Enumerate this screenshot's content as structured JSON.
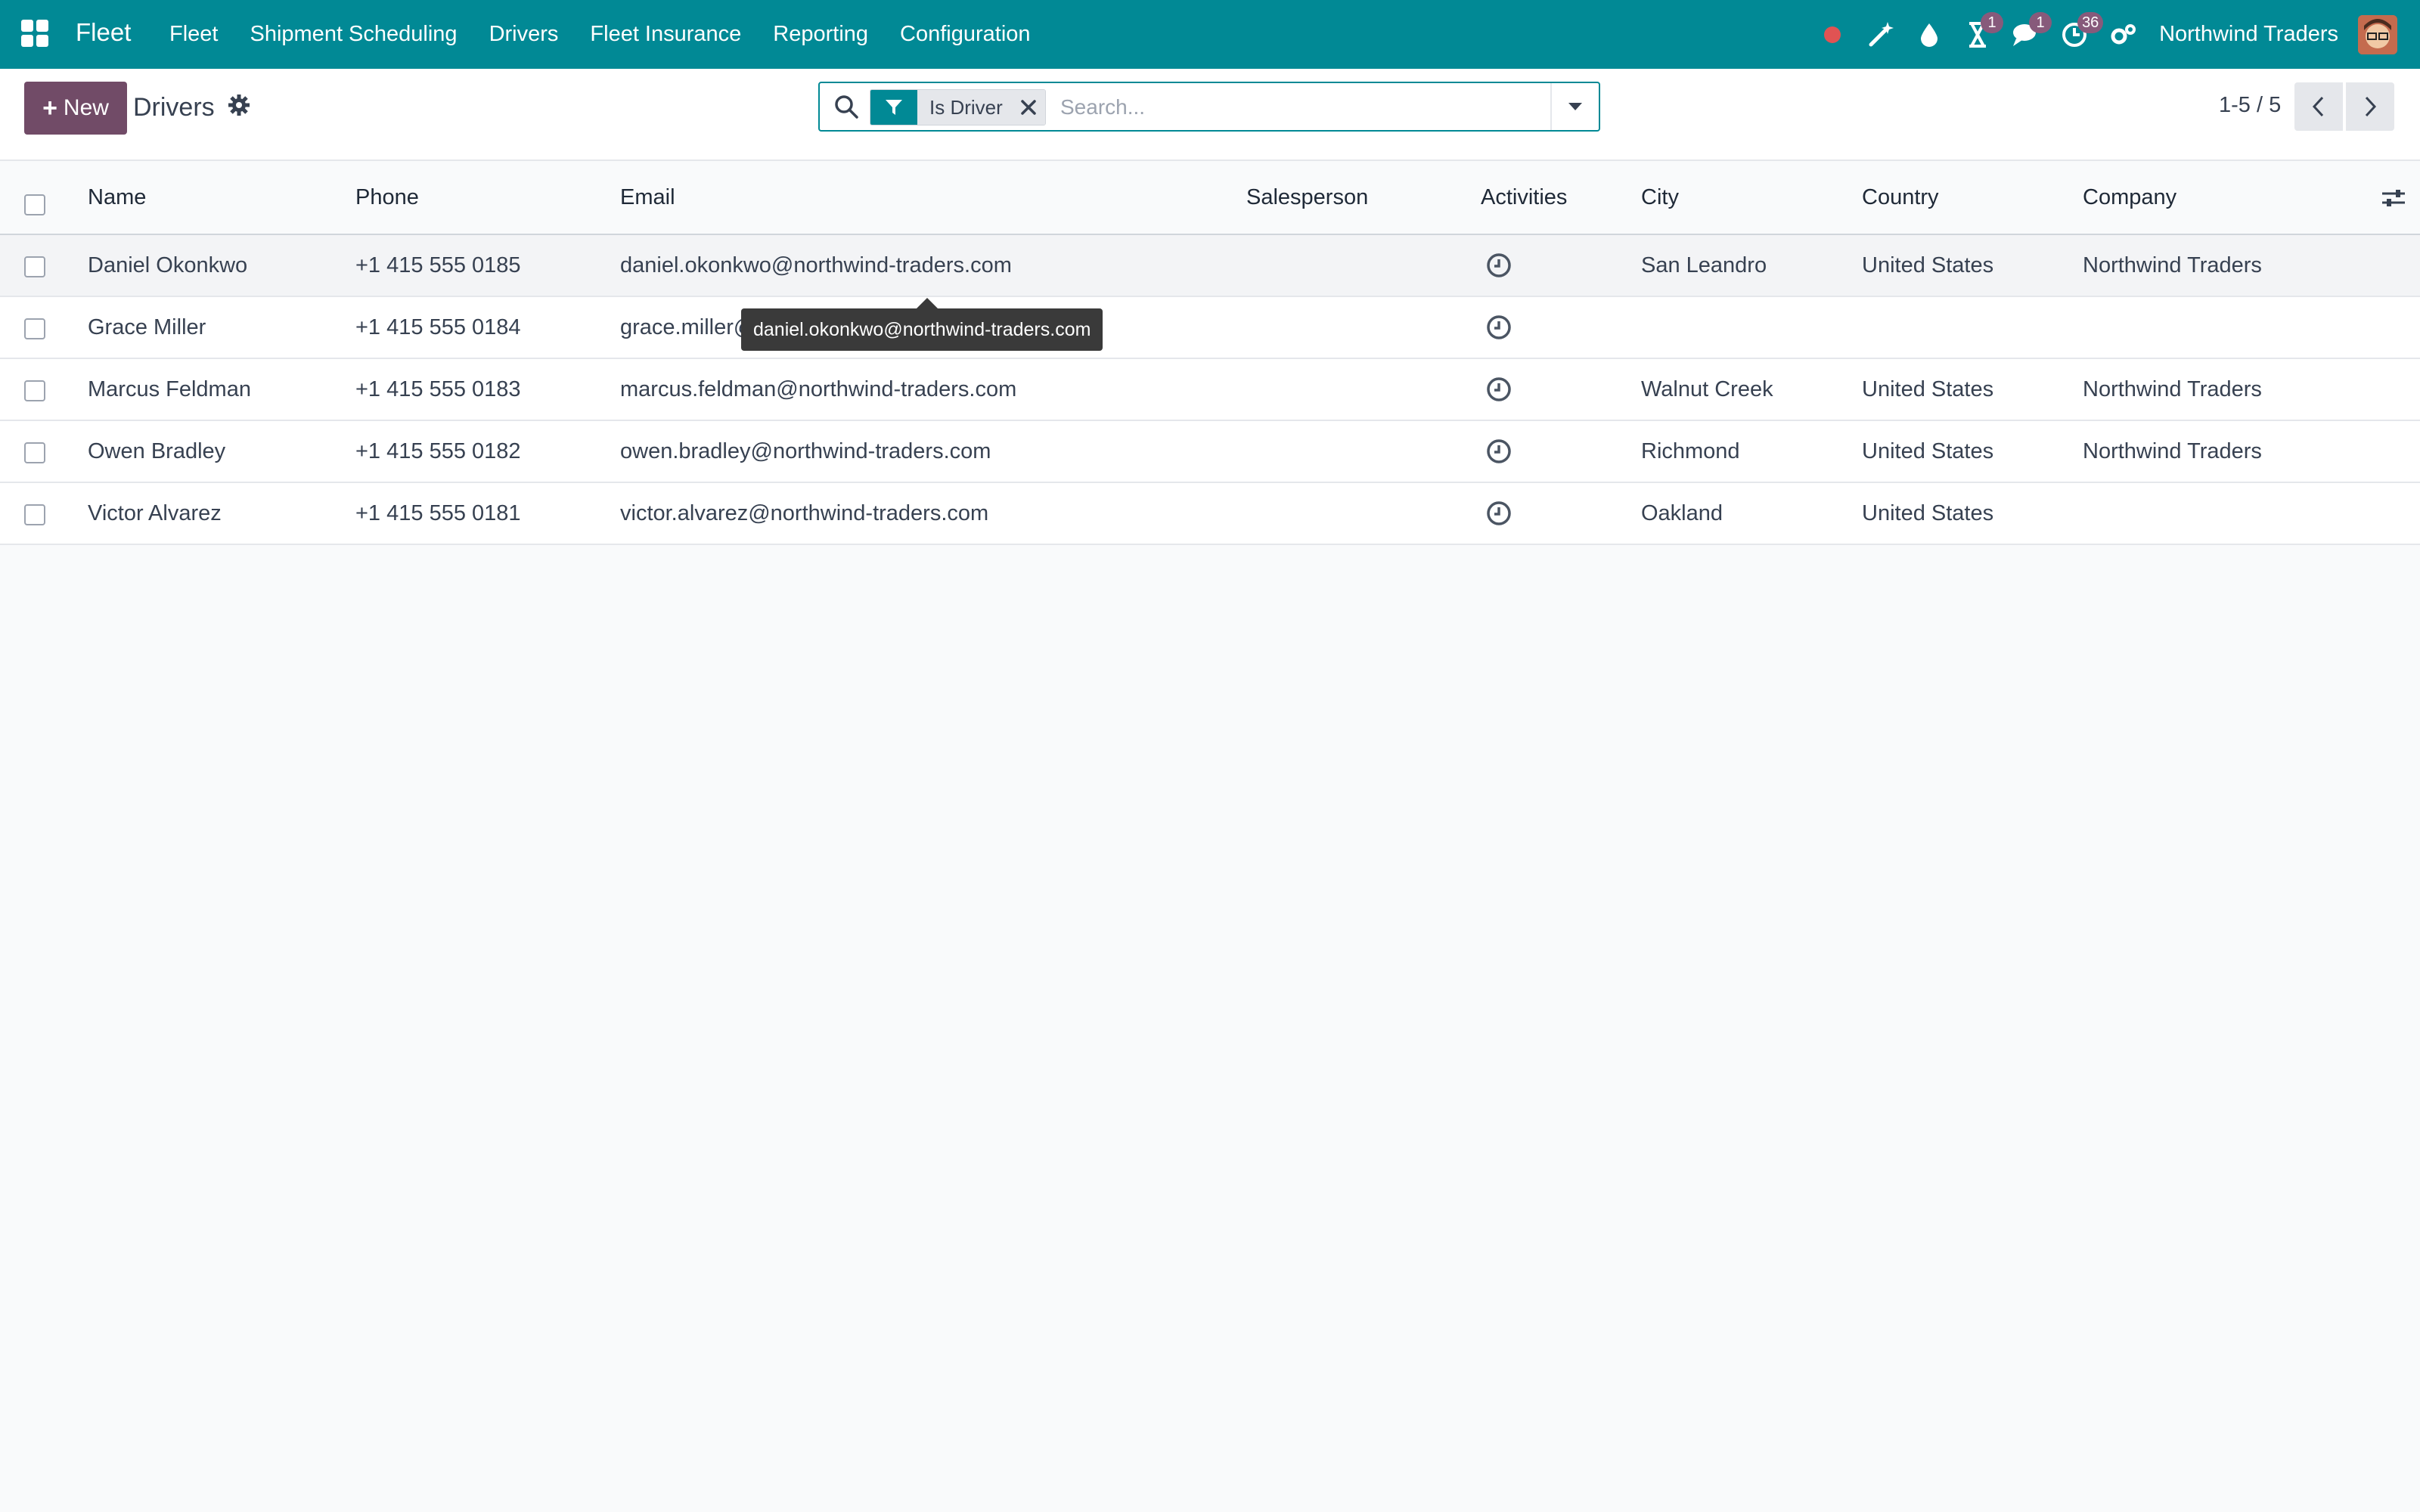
{
  "navbar": {
    "brand": "Fleet",
    "menu": [
      "Fleet",
      "Shipment Scheduling",
      "Drivers",
      "Fleet Insurance",
      "Reporting",
      "Configuration"
    ],
    "badges": {
      "activity_hourglass": "1",
      "messages": "1",
      "clock": "36"
    },
    "company": "Northwind Traders",
    "colors": {
      "bar": "#018995",
      "badge": "#875a7b",
      "record": "#e05353"
    }
  },
  "control": {
    "new_label": "New",
    "breadcrumb": "Drivers",
    "search": {
      "facet_label": "Is Driver",
      "placeholder": "Search..."
    },
    "pager": "1-5 / 5"
  },
  "list": {
    "columns": [
      "Name",
      "Phone",
      "Email",
      "Salesperson",
      "Activities",
      "City",
      "Country",
      "Company"
    ],
    "rows": [
      {
        "name": "Daniel Okonkwo",
        "phone": "+1 415 555 0185",
        "email": "daniel.okonkwo@northwind-traders.com",
        "salesperson": "",
        "city": "San Leandro",
        "country": "United States",
        "company": "Northwind Traders"
      },
      {
        "name": "Grace Miller",
        "phone": "+1 415 555 0184",
        "email": "grace.miller@northwind-traders.com",
        "salesperson": "",
        "city": "",
        "country": "",
        "company": ""
      },
      {
        "name": "Marcus Feldman",
        "phone": "+1 415 555 0183",
        "email": "marcus.feldman@northwind-traders.com",
        "salesperson": "",
        "city": "Walnut Creek",
        "country": "United States",
        "company": "Northwind Traders"
      },
      {
        "name": "Owen Bradley",
        "phone": "+1 415 555 0182",
        "email": "owen.bradley@northwind-traders.com",
        "salesperson": "",
        "city": "Richmond",
        "country": "United States",
        "company": "Northwind Traders"
      },
      {
        "name": "Victor Alvarez",
        "phone": "+1 415 555 0181",
        "email": "victor.alvarez@northwind-traders.com",
        "salesperson": "",
        "city": "Oakland",
        "country": "United States",
        "company": ""
      }
    ]
  },
  "tooltip": "daniel.okonkwo@northwind-traders.com"
}
